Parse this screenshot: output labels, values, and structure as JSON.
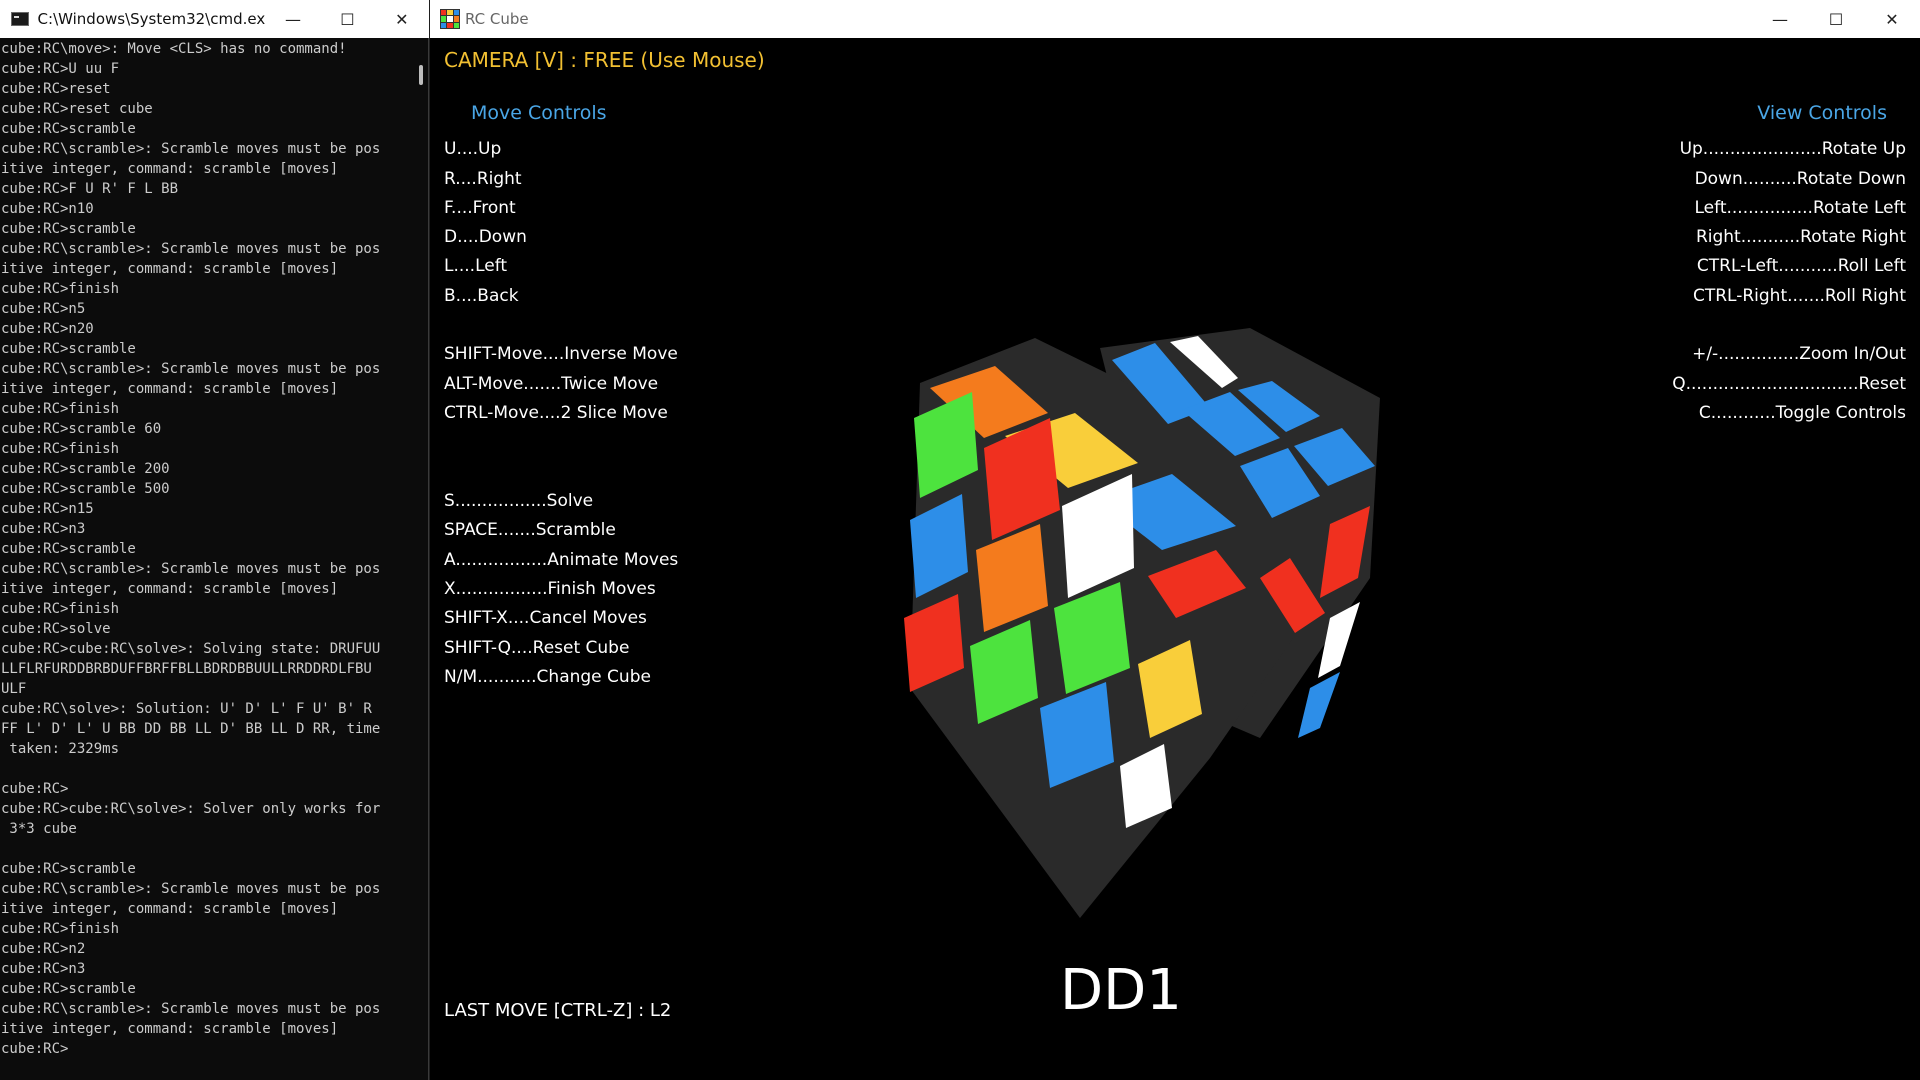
{
  "cmd": {
    "title": "C:\\Windows\\System32\\cmd.ex...",
    "lines": [
      "cube:RC\\move>: Move <CLS> has no command!",
      "cube:RC>U uu F",
      "cube:RC>reset",
      "cube:RC>reset cube",
      "cube:RC>scramble",
      "cube:RC\\scramble>: Scramble moves must be pos",
      "itive integer, command: scramble [moves]",
      "cube:RC>F U R' F L BB",
      "cube:RC>n10",
      "cube:RC>scramble",
      "cube:RC\\scramble>: Scramble moves must be pos",
      "itive integer, command: scramble [moves]",
      "cube:RC>finish",
      "cube:RC>n5",
      "cube:RC>n20",
      "cube:RC>scramble",
      "cube:RC\\scramble>: Scramble moves must be pos",
      "itive integer, command: scramble [moves]",
      "cube:RC>finish",
      "cube:RC>scramble 60",
      "cube:RC>finish",
      "cube:RC>scramble 200",
      "cube:RC>scramble 500",
      "cube:RC>n15",
      "cube:RC>n3",
      "cube:RC>scramble",
      "cube:RC\\scramble>: Scramble moves must be pos",
      "itive integer, command: scramble [moves]",
      "cube:RC>finish",
      "cube:RC>solve",
      "cube:RC>cube:RC\\solve>: Solving state: DRUFUU",
      "LLFLRFURDDBRBDUFFBRFFBLLBDRDBBUULLRRDDRDLFBU",
      "ULF",
      "cube:RC\\solve>: Solution: U' D' L' F U' B' R",
      "FF L' D' L' U BB DD BB LL D' BB LL D RR, time",
      " taken: 2329ms",
      "",
      "cube:RC>",
      "cube:RC>cube:RC\\solve>: Solver only works for",
      " 3*3 cube",
      "",
      "cube:RC>scramble",
      "cube:RC\\scramble>: Scramble moves must be pos",
      "itive integer, command: scramble [moves]",
      "cube:RC>finish",
      "cube:RC>n2",
      "cube:RC>n3",
      "cube:RC>scramble",
      "cube:RC\\scramble>: Scramble moves must be pos",
      "itive integer, command: scramble [moves]",
      "cube:RC>"
    ]
  },
  "window_buttons": {
    "minimize": "—",
    "maximize": "☐",
    "close": "✕"
  },
  "rc": {
    "title": "RC Cube",
    "camera": "CAMERA [V] : FREE (Use Mouse)",
    "move_controls_title": "Move Controls",
    "view_controls_title": "View Controls",
    "move_controls": [
      "U....Up",
      "R....Right",
      "F....Front",
      "D....Down",
      "L....Left",
      "B....Back",
      "SHIFT-Move....Inverse Move",
      "ALT-Move.......Twice Move",
      "CTRL-Move....2 Slice Move",
      "S.................Solve",
      "SPACE.......Scramble",
      "A.................Animate Moves",
      "X.................Finish Moves",
      "SHIFT-X....Cancel Moves",
      "SHIFT-Q....Reset Cube",
      "N/M...........Change Cube"
    ],
    "view_controls": [
      "Up......................Rotate Up",
      "Down..........Rotate Down",
      "Left................Rotate Left",
      "Right...........Rotate Right",
      "CTRL-Left...........Roll Left",
      "CTRL-Right.......Roll Right",
      "+/-...............Zoom In/Out",
      "Q................................Reset",
      "C............Toggle Controls"
    ],
    "last_move": "LAST MOVE [CTRL-Z] : L2",
    "cube_name": "DD1"
  },
  "colors": {
    "accent_yellow": "#f2c032",
    "accent_blue": "#4aa6e6",
    "sticker_blue": "#2d8ee8",
    "sticker_red": "#f0301f",
    "sticker_orange": "#f47b1d",
    "sticker_yellow": "#f9ce3a",
    "sticker_green": "#4de33e",
    "sticker_white": "#ffffff",
    "cube_body": "#2a2a2a"
  }
}
